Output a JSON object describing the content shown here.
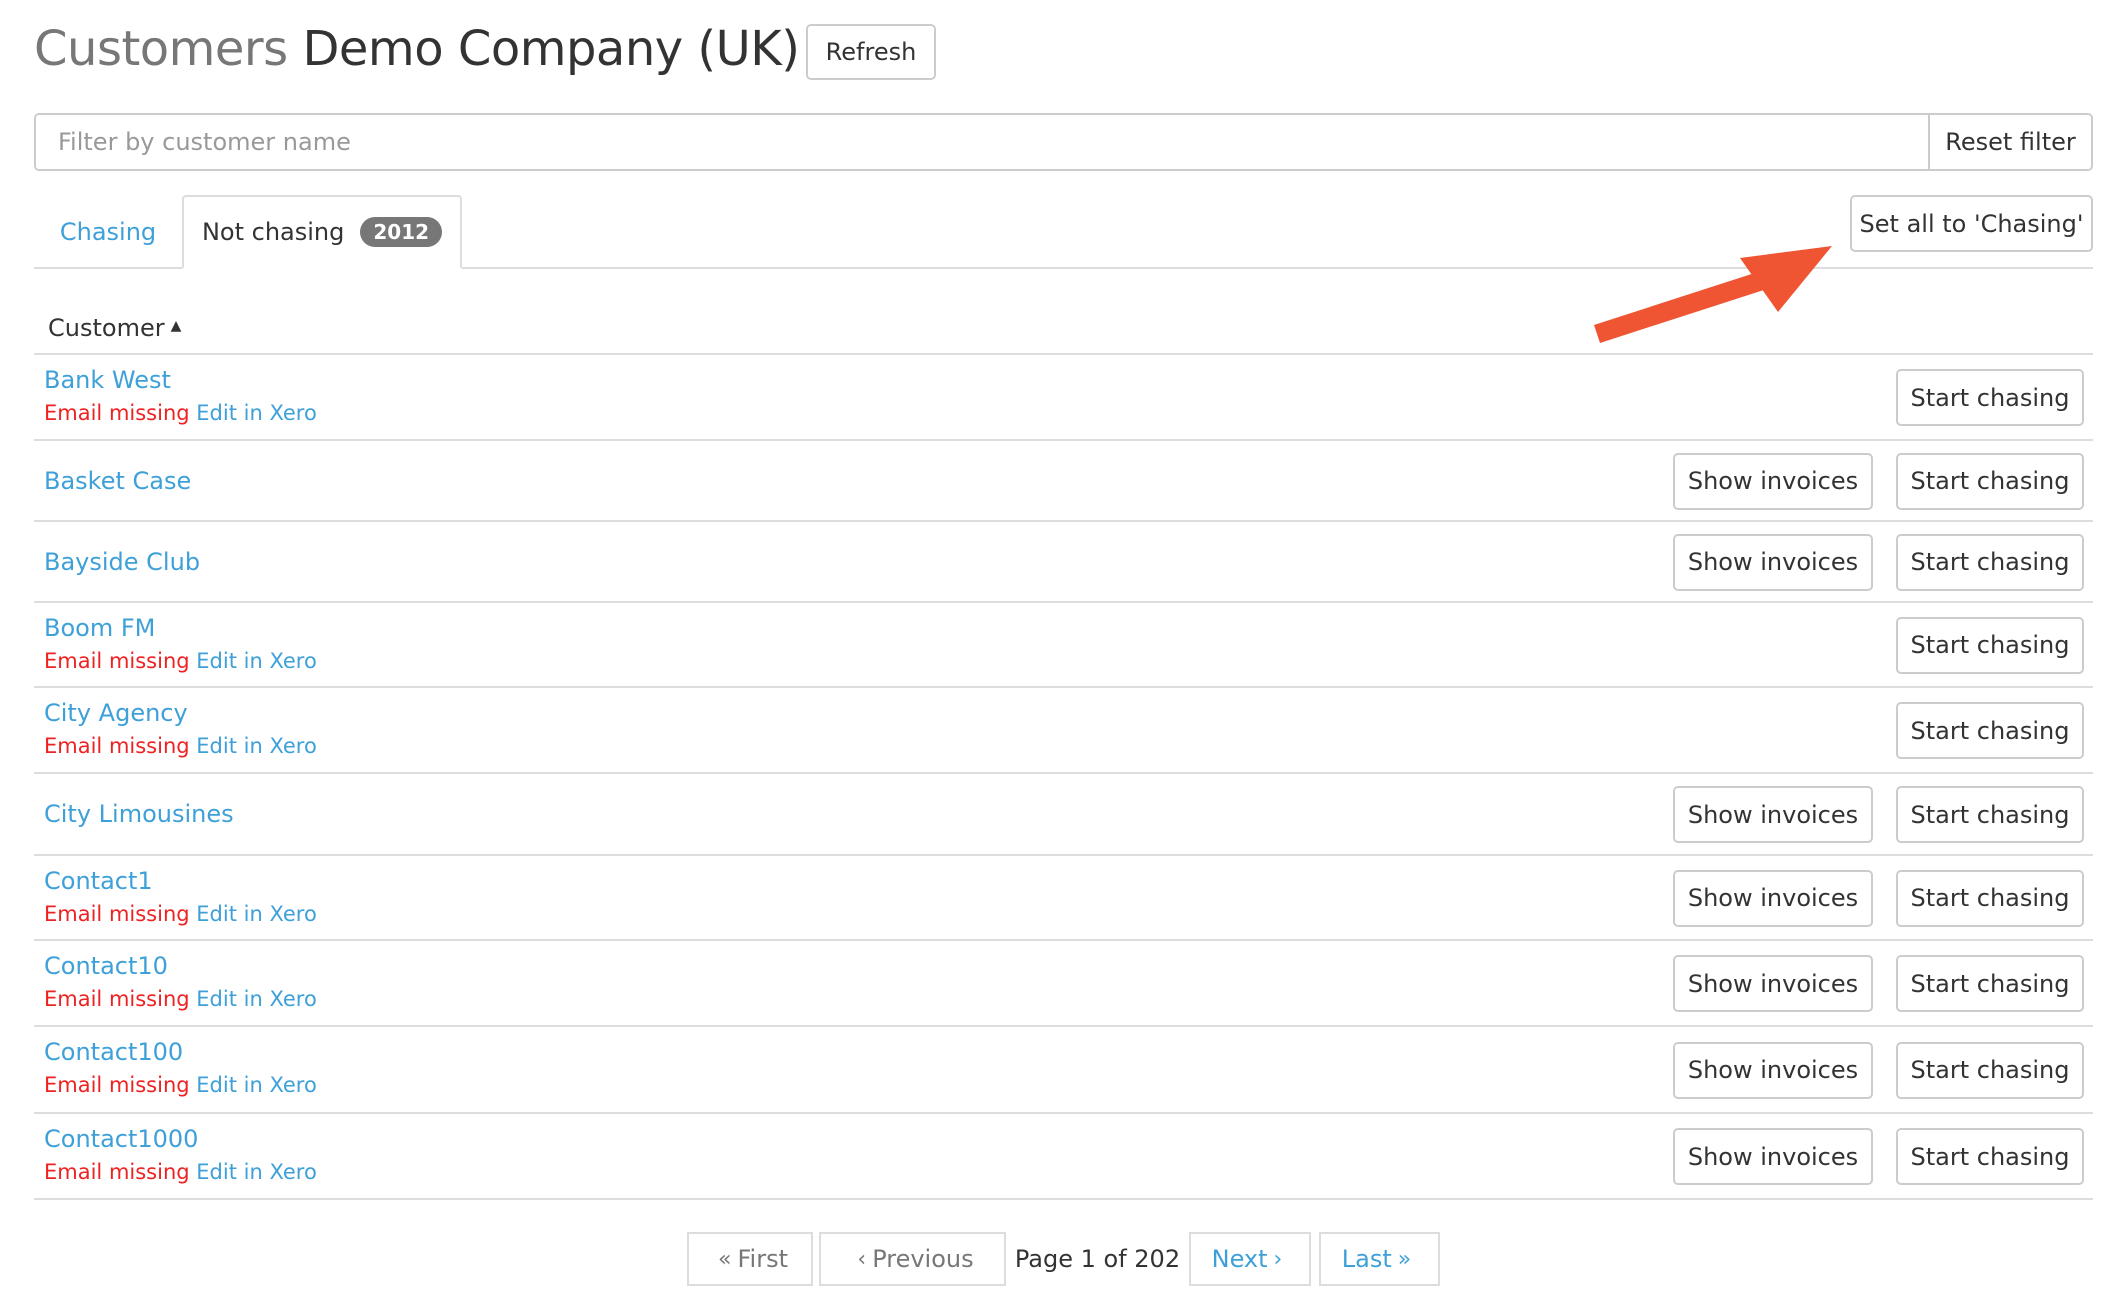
{
  "header": {
    "title_prefix": "Customers",
    "company": "Demo Company (UK)",
    "refresh_label": "Refresh"
  },
  "filter": {
    "placeholder": "Filter by customer name",
    "value": "",
    "reset_label": "Reset filter"
  },
  "tabs": [
    {
      "label": "Chasing",
      "active": false
    },
    {
      "label": "Not chasing",
      "badge": "2012",
      "active": true
    }
  ],
  "set_all_label": "Set all to 'Chasing'",
  "annotation": {
    "arrow_color": "#ef5533",
    "icon": "arrow-pointer"
  },
  "table": {
    "column_header": "Customer",
    "sort_icon": "caret-up-icon",
    "email_missing_label": "Email missing",
    "edit_label": "Edit in Xero",
    "show_invoices_label": "Show invoices",
    "start_chasing_label": "Start chasing",
    "rows": [
      {
        "name": "Bank West",
        "email_missing": true,
        "show_invoices": false
      },
      {
        "name": "Basket Case",
        "email_missing": false,
        "show_invoices": true
      },
      {
        "name": "Bayside Club",
        "email_missing": false,
        "show_invoices": true
      },
      {
        "name": "Boom FM",
        "email_missing": true,
        "show_invoices": false
      },
      {
        "name": "City Agency",
        "email_missing": true,
        "show_invoices": false
      },
      {
        "name": "City Limousines",
        "email_missing": false,
        "show_invoices": true
      },
      {
        "name": "Contact1",
        "email_missing": true,
        "show_invoices": true
      },
      {
        "name": "Contact10",
        "email_missing": true,
        "show_invoices": true
      },
      {
        "name": "Contact100",
        "email_missing": true,
        "show_invoices": true
      },
      {
        "name": "Contact1000",
        "email_missing": true,
        "show_invoices": true
      }
    ]
  },
  "pagination": {
    "first_label": "First",
    "previous_label": "Previous",
    "page_info": "Page 1 of 202",
    "current_page": 1,
    "total_pages": 202,
    "next_label": "Next",
    "last_label": "Last"
  },
  "colors": {
    "link": "#3ea0d8",
    "error": "#ee2222",
    "badge": "#777777",
    "annotation_arrow": "#ef5533"
  }
}
